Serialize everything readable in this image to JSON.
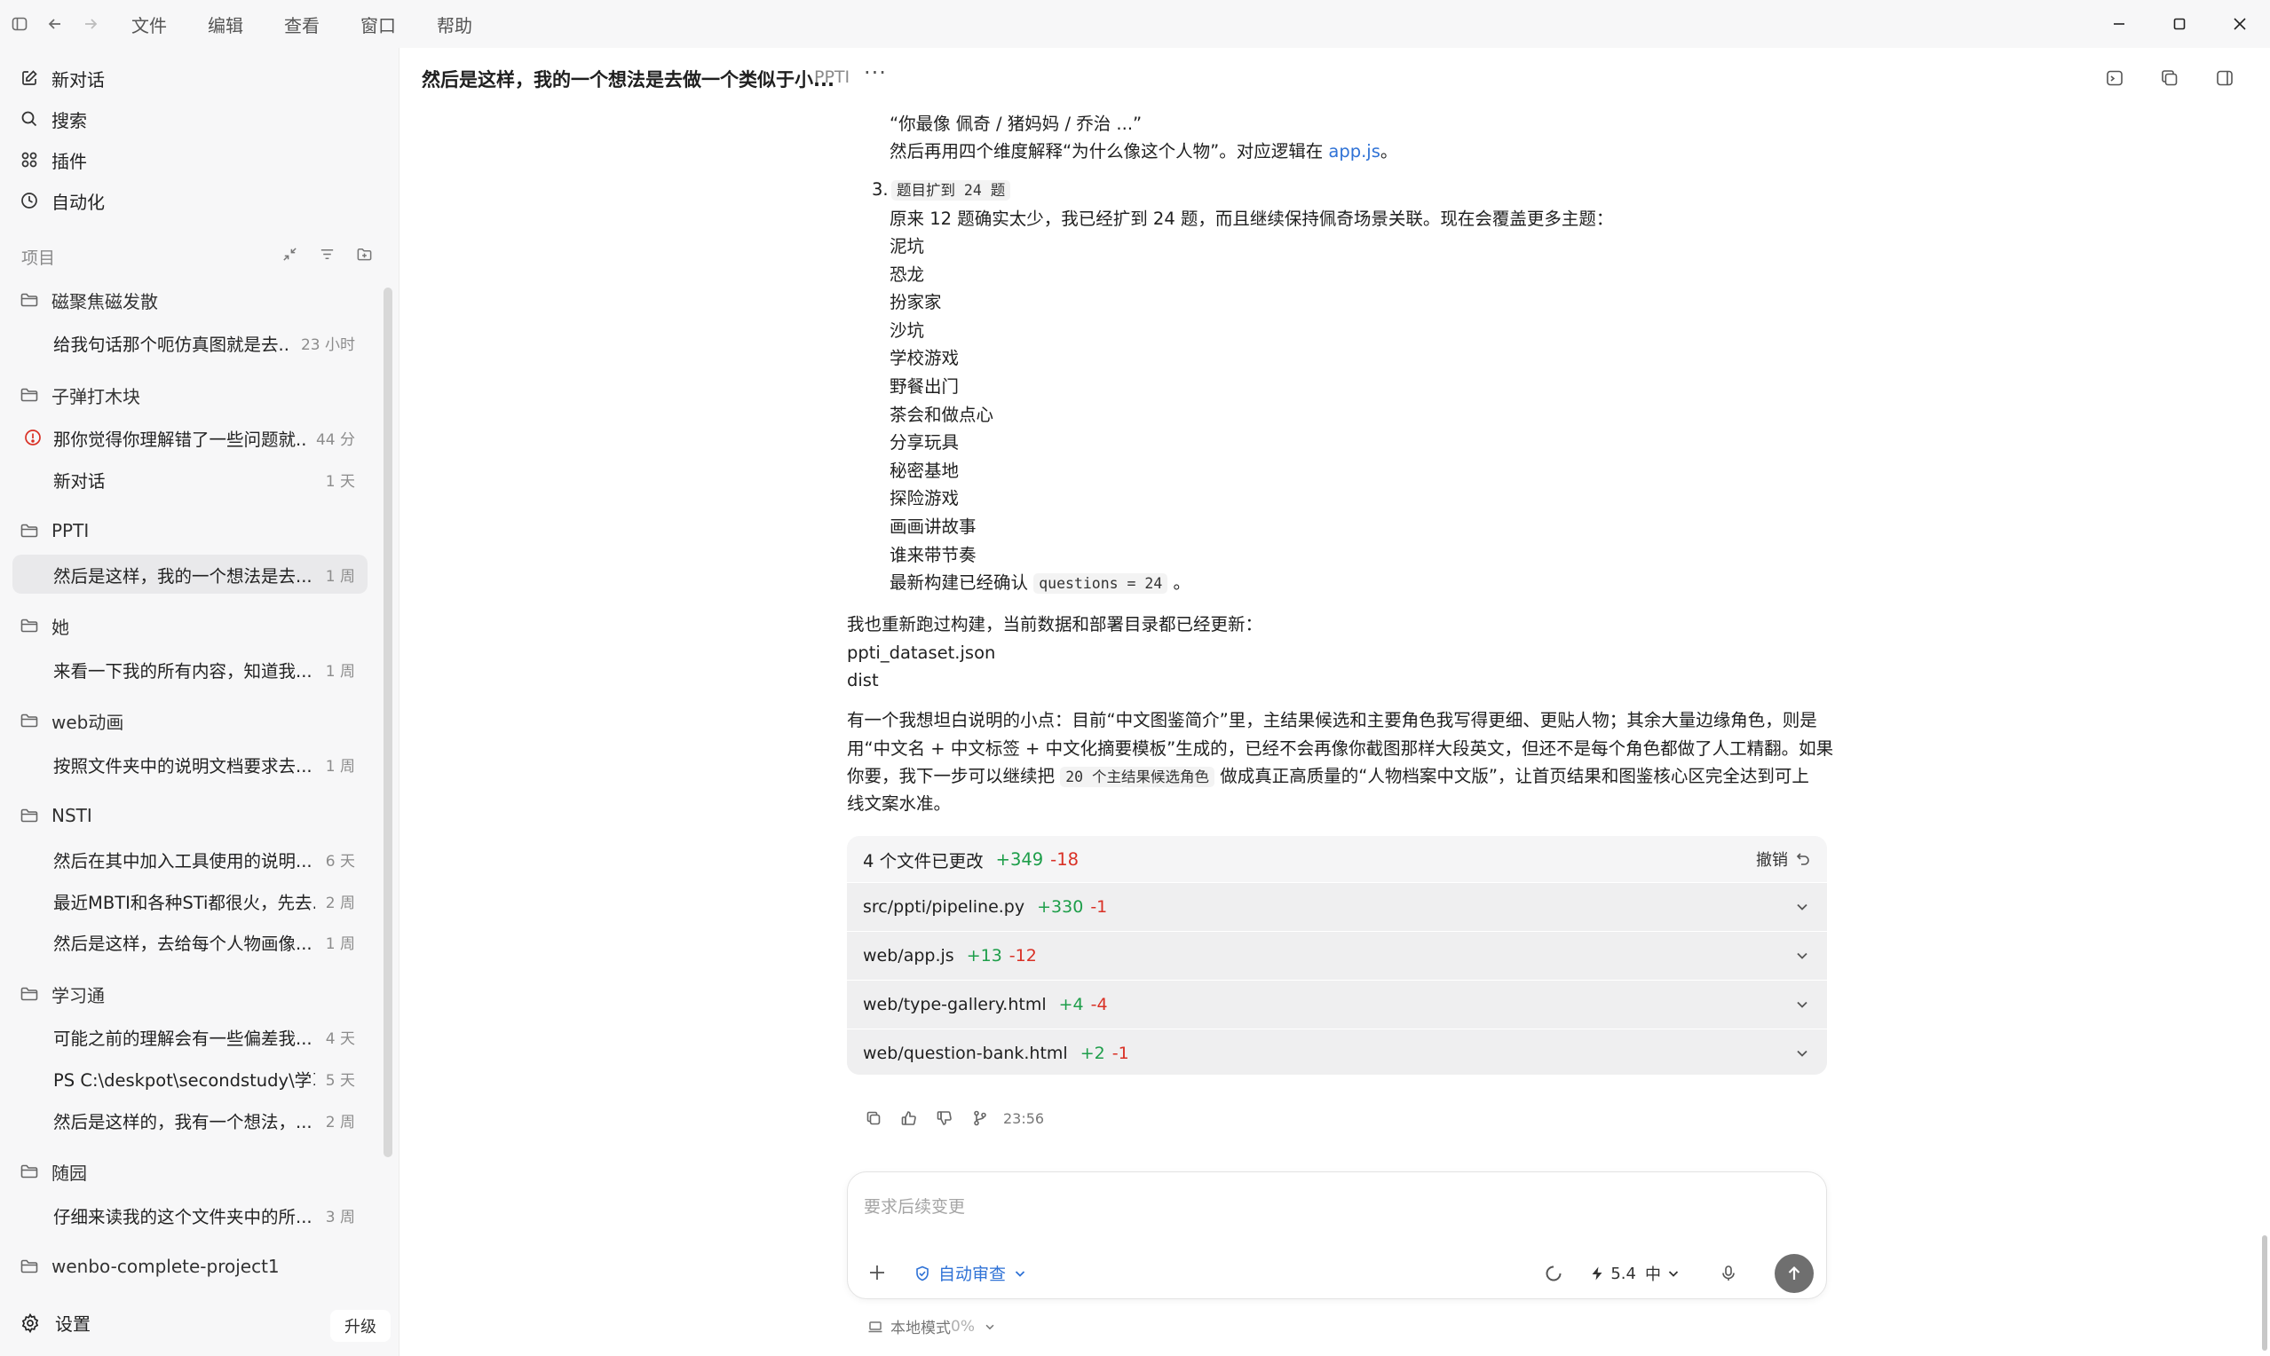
{
  "menu": {
    "file": "文件",
    "edit": "编辑",
    "view": "查看",
    "window": "窗口",
    "help": "帮助"
  },
  "sidebar": {
    "nav": {
      "new_chat": "新对话",
      "search": "搜索",
      "plugins": "插件",
      "automation": "自动化"
    },
    "section_label": "项目",
    "projects": [
      {
        "name": "磁聚焦磁发散",
        "conversations": [
          {
            "title": "给我句话那个呃仿真图就是去...",
            "ago": "23 小时"
          }
        ]
      },
      {
        "name": "子弹打木块",
        "conversations": [
          {
            "title": "那你觉得你理解错了一些问题就...",
            "ago": "44 分",
            "warning": true
          },
          {
            "title": "新对话",
            "ago": "1 天"
          }
        ]
      },
      {
        "name": "PPTI",
        "conversations": [
          {
            "title": "然后是这样，我的一个想法是去...",
            "ago": "1 周",
            "active": true
          }
        ]
      },
      {
        "name": "她",
        "conversations": [
          {
            "title": "来看一下我的所有内容，知道我...",
            "ago": "1 周"
          }
        ]
      },
      {
        "name": "web动画",
        "conversations": [
          {
            "title": "按照文件夹中的说明文档要求去...",
            "ago": "1 周"
          }
        ]
      },
      {
        "name": "NSTI",
        "conversations": [
          {
            "title": "然后在其中加入工具使用的说明...",
            "ago": "6 天"
          },
          {
            "title": "最近MBTI和各种STi都很火，先去...",
            "ago": "2 周"
          },
          {
            "title": "然后是这样，去给每个人物画像...",
            "ago": "1 周"
          }
        ]
      },
      {
        "name": "学习通",
        "conversations": [
          {
            "title": "可能之前的理解会有一些偏差我...",
            "ago": "4 天"
          },
          {
            "title": "PS C:\\deskpot\\secondstudy\\学习...",
            "ago": "5 天"
          },
          {
            "title": "然后是这样的，我有一个想法，...",
            "ago": "2 周"
          }
        ]
      },
      {
        "name": "随园",
        "conversations": [
          {
            "title": "仔细来读我的这个文件夹中的所...",
            "ago": "3 周"
          }
        ]
      },
      {
        "name": "wenbo-complete-project1",
        "conversations": []
      }
    ],
    "settings": "设置",
    "upgrade": "升级"
  },
  "header": {
    "title": "然后是这样，我的一个想法是去做一个类似于小...",
    "project": "PPTI",
    "more": "···"
  },
  "message": {
    "quote_line": "“你最像 佩奇 / 猪妈妈 / 乔治 ...”",
    "explain_pre": "然后再用四个维度解释“为什么像这个人物”。对应逻辑在 ",
    "explain_link": "app.js",
    "explain_post": "。",
    "item3_num": "3.",
    "item3_code": "题目扩到 24 题",
    "item3_desc": "原来 12 题确实太少，我已经扩到 24 题，而且继续保持佩奇场景关联。现在会覆盖更多主题：",
    "topics": [
      "泥坑",
      "恐龙",
      "扮家家",
      "沙坑",
      "学校游戏",
      "野餐出门",
      "茶会和做点心",
      "分享玩具",
      "秘密基地",
      "探险游戏",
      "画画讲故事",
      "谁来带节奏"
    ],
    "build_pre": "最新构建已经确认 ",
    "build_code": "questions = 24",
    "build_post": " 。",
    "rebuild": "我也重新跑过构建，当前数据和部署目录都已经更新：",
    "link_dataset": "ppti_dataset.json",
    "link_dist": "dist",
    "note_line1": "有一个我想坦白说明的小点：目前“中文图鉴简介”里，主结果候选和主要角色我写得更细、更贴人物；其余大量边缘角色，则是",
    "note_line2": "用“中文名 + 中文标签 + 中文化摘要模板”生成的，已经不会再像你截图那样大段英文，但还不是每个角色都做了人工精翻。如果",
    "note_line3_pre": "你要，我下一步可以继续把 ",
    "note_line3_code": "20 个主结果候选角色",
    "note_line3_post": " 做成真正高质量的“人物档案中文版”，让首页结果和图鉴核心区完全达到可上",
    "note_line4": "线文案水准。"
  },
  "changes": {
    "summary": "4 个文件已更改",
    "added": "+349",
    "removed": "-18",
    "undo": "撤销",
    "files": [
      {
        "path": "src/ppti/pipeline.py",
        "added": "+330",
        "removed": "-1"
      },
      {
        "path": "web/app.js",
        "added": "+13",
        "removed": "-12"
      },
      {
        "path": "web/type-gallery.html",
        "added": "+4",
        "removed": "-4"
      },
      {
        "path": "web/question-bank.html",
        "added": "+2",
        "removed": "-1"
      }
    ]
  },
  "actions": {
    "time": "23:56"
  },
  "composer": {
    "placeholder": "要求后续变更",
    "review": "自动审查",
    "model_version": "5.4",
    "model_level": "中"
  },
  "footer": {
    "mode": "本地模式",
    "percent": "0%"
  },
  "colors": {
    "link": "#2f72d6",
    "added": "#1e9e4a",
    "removed": "#d93025",
    "sidebar_bg": "#f7f7f8"
  }
}
